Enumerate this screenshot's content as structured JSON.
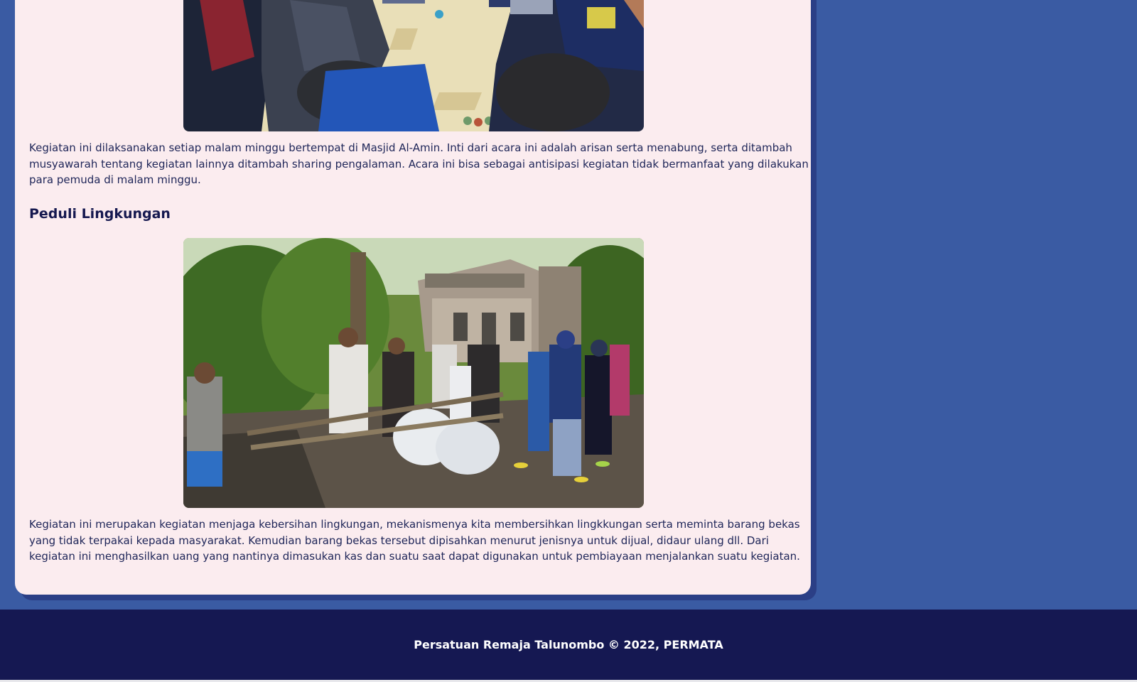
{
  "content": {
    "section1": {
      "image_alt": "Kegiatan malam minggu di Masjid Al-Amin",
      "paragraph": "Kegiatan ini dilaksanakan setiap malam minggu bertempat di Masjid Al-Amin. Inti dari acara ini adalah arisan serta menabung, serta ditambah musyawarah tentang kegiatan lainnya ditambah sharing pengalaman. Acara ini bisa sebagai antisipasi kegiatan tidak bermanfaat yang dilakukan para pemuda di malam minggu."
    },
    "section2": {
      "heading": "Peduli Lingkungan",
      "image_alt": "Kegiatan peduli lingkungan",
      "paragraph": "Kegiatan ini merupakan kegiatan menjaga kebersihan lingkungan, mekanismenya kita membersihkan lingkkungan serta meminta barang bekas yang tidak terpakai kepada masyarakat. Kemudian barang bekas tersebut dipisahkan menurut jenisnya untuk dijual, didaur ulang dll. Dari kegiatan ini menghasilkan uang yang nantinya dimasukan kas dan suatu saat dapat digunakan untuk pembiayaan menjalankan suatu kegiatan."
    }
  },
  "footer": {
    "text": "Persatuan Remaja Talunombo © 2022, PERMATA"
  },
  "colors": {
    "page_background": "#3a5ba3",
    "card_background": "#fbecef",
    "footer_background": "#151852",
    "text": "#1e2558"
  }
}
